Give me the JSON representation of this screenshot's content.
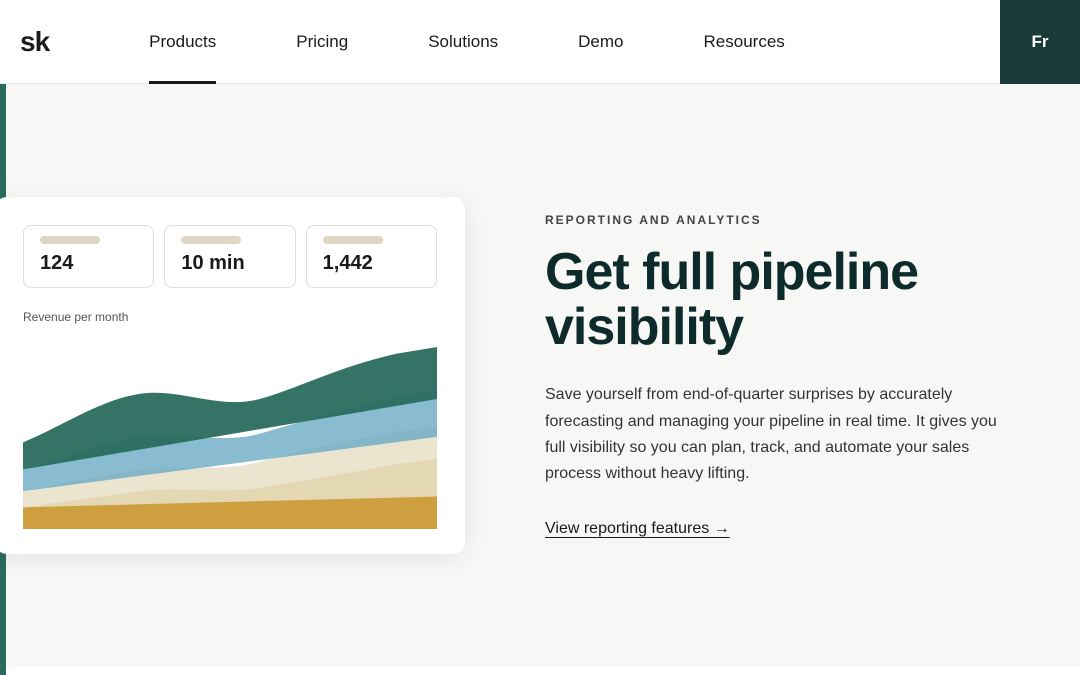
{
  "brand": {
    "logo_text": "sk"
  },
  "nav": {
    "items": [
      {
        "label": "Products",
        "active": true
      },
      {
        "label": "Pricing",
        "active": false
      },
      {
        "label": "Solutions",
        "active": false
      },
      {
        "label": "Demo",
        "active": false
      },
      {
        "label": "Resources",
        "active": false
      }
    ],
    "cta_label": "Fr"
  },
  "dashboard": {
    "metrics": [
      {
        "value": "124",
        "bar_color": "#ddd8c4"
      },
      {
        "value": "10 min",
        "bar_color": "#ddd8c4"
      },
      {
        "value": "1,442",
        "bar_color": "#ddd8c4"
      }
    ],
    "chart_label": "Revenue per month"
  },
  "content": {
    "section_label": "REPORTING AND ANALYTICS",
    "headline_line1": "Get full pipeline",
    "headline_line2": "visibility",
    "description": "Save yourself from end-of-quarter surprises by accurately forecasting and managing your pipeline in real time. It gives you full visibility so you can plan, track, and automate your sales process without heavy lifting.",
    "cta_text": "View reporting features →"
  }
}
